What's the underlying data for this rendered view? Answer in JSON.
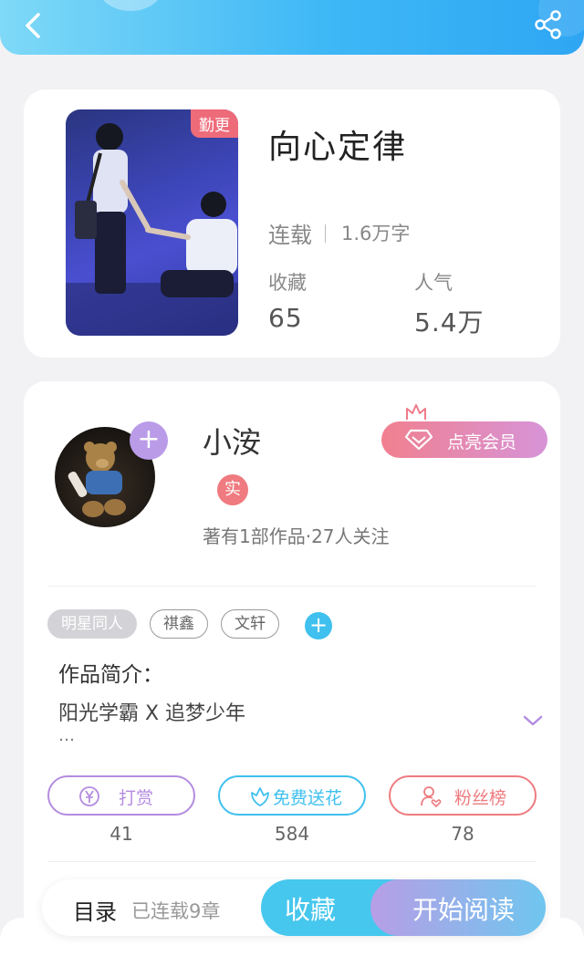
{
  "book": {
    "title": "向心定律",
    "update_badge": "勤更",
    "status": "连载",
    "word_count": "1.6万字",
    "favorites_label": "收藏",
    "favorites_value": "65",
    "popularity_label": "人气",
    "popularity_value": "5.4万"
  },
  "author": {
    "name": "小洝",
    "real_badge": "实",
    "stats": "著有1部作品·27人关注",
    "follow_symbol": "+",
    "vip_label": "点亮会员"
  },
  "tags": [
    "明星同人",
    "祺鑫",
    "文轩"
  ],
  "tag_add_symbol": "+",
  "intro": {
    "label": "作品简介：",
    "text": "阳光学霸  X  追梦少年",
    "more": "…"
  },
  "actions": [
    {
      "label": "打赏",
      "count": "41",
      "color": "#b48ce0",
      "icon": "yen-icon"
    },
    {
      "label": "免费送花",
      "count": "584",
      "color": "#3fc0ee",
      "icon": "flower-icon"
    },
    {
      "label": "粉丝榜",
      "count": "78",
      "color": "#ee7b7f",
      "icon": "fan-rank-icon"
    }
  ],
  "bottom_bar": {
    "toc_label": "目录",
    "chapters_text": "已连载9章",
    "favorite_label": "收藏",
    "read_label": "开始阅读"
  }
}
